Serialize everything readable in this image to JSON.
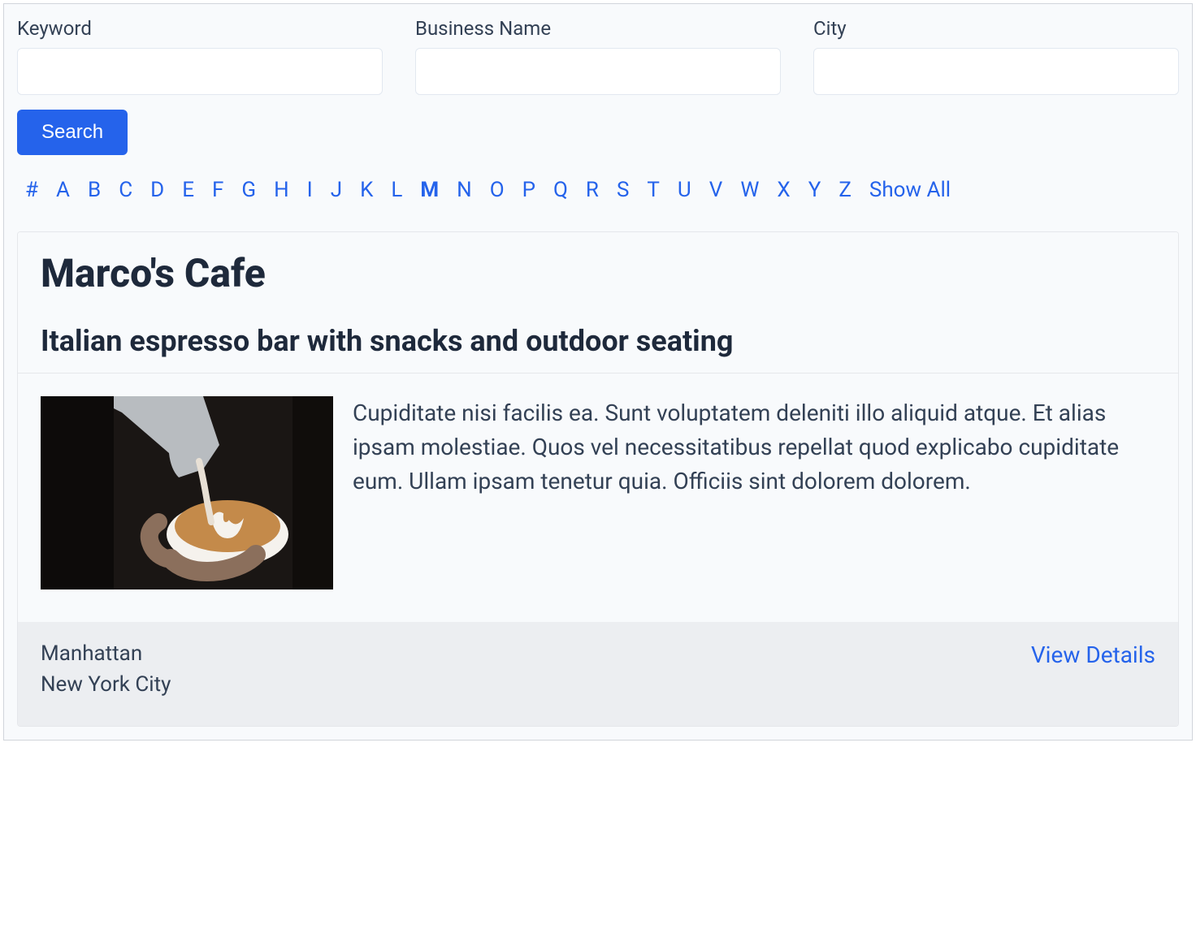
{
  "search": {
    "keyword_label": "Keyword",
    "business_label": "Business Name",
    "city_label": "City",
    "keyword_value": "",
    "business_value": "",
    "city_value": "",
    "button_label": "Search"
  },
  "alpha_nav": {
    "items": [
      "#",
      "A",
      "B",
      "C",
      "D",
      "E",
      "F",
      "G",
      "H",
      "I",
      "J",
      "K",
      "L",
      "M",
      "N",
      "O",
      "P",
      "Q",
      "R",
      "S",
      "T",
      "U",
      "V",
      "W",
      "X",
      "Y",
      "Z"
    ],
    "show_all_label": "Show All",
    "active": "M"
  },
  "listing": {
    "title": "Marco's Cafe",
    "subtitle": "Italian espresso bar with snacks and outdoor seating",
    "image_alt": "latte-art-coffee",
    "description": "Cupiditate nisi facilis ea. Sunt voluptatem deleniti illo aliquid atque. Et alias ipsam molestiae. Quos vel necessitatibus repellat quod explicabo cupiditate eum. Ullam ipsam tenetur quia. Officiis sint dolorem dolorem.",
    "location_line1": "Manhattan",
    "location_line2": "New York City",
    "view_details_label": "View Details"
  }
}
